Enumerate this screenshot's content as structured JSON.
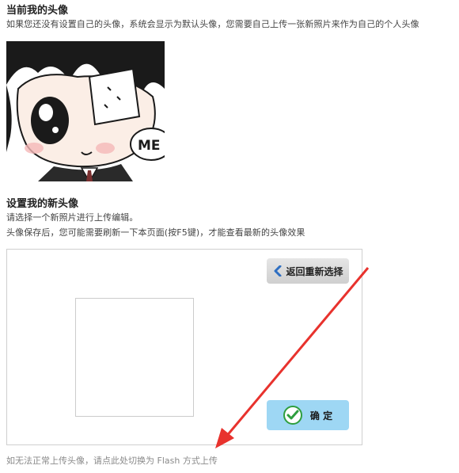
{
  "current_avatar": {
    "title": "当前我的头像",
    "description": "如果您还没有设置自己的头像，系统会显示为默认头像，您需要自己上传一张新照片来作为自己的个人头像",
    "image_text": "ME"
  },
  "new_avatar": {
    "title": "设置我的新头像",
    "instruction": "请选择一个新照片进行上传编辑。",
    "note": "头像保存后，您可能需要刷新一下本页面(按F5键)，才能查看最新的头像效果"
  },
  "upload_panel": {
    "back_button_label": "返回重新选择",
    "confirm_button_label": "确 定"
  },
  "flash_link": "如无法正常上传头像，请点此处切换为 Flash 方式上传",
  "colors": {
    "annotation_arrow": "#e8322d",
    "confirm_button_bg": "#9ed7f4",
    "back_button_bg": "#d8d8d8",
    "check_icon": "#2e9e3e"
  }
}
